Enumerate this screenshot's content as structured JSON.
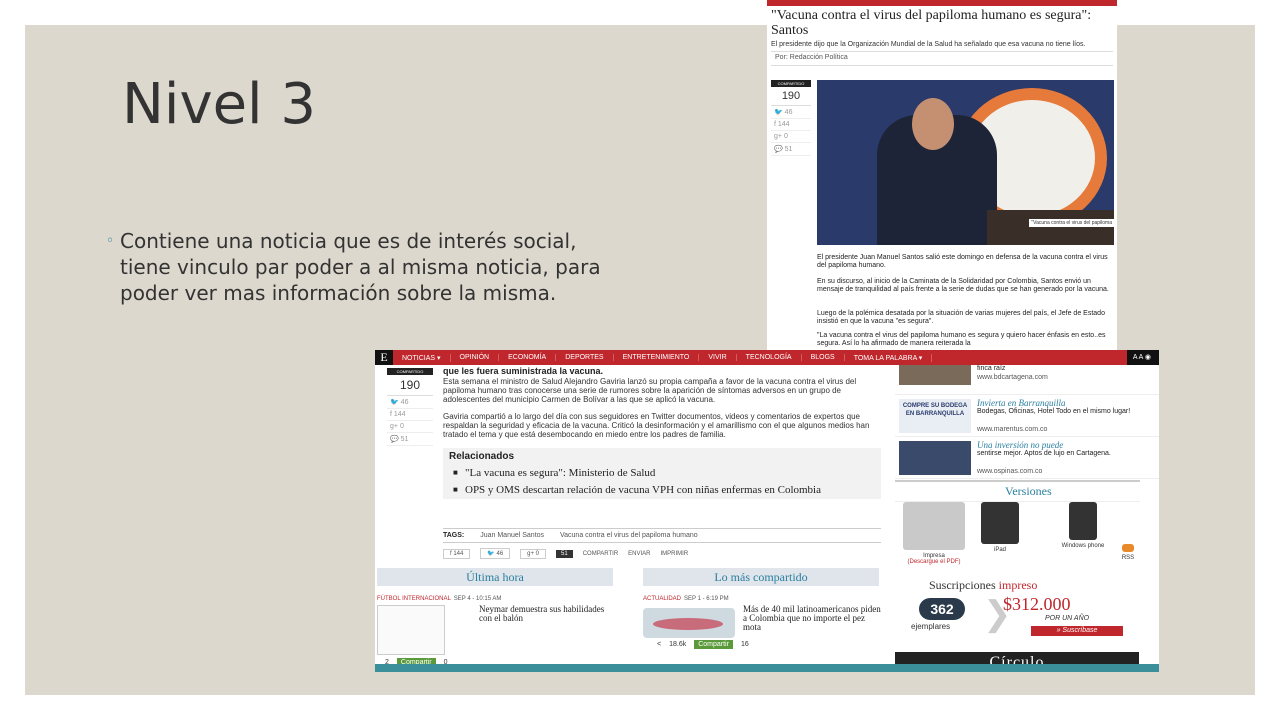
{
  "slide": {
    "title": "Nivel 3",
    "bullet": "Contiene una noticia que es de interés social, tiene vinculo par poder a al misma noticia, para poder ver mas información sobre la misma."
  },
  "top_article": {
    "headline": "\"Vacuna contra el virus del papiloma humano es segura\": Santos",
    "subheadline": "El presidente dijo que la Organización Mundial de la Salud ha señalado que esa vacuna no tiene líos.",
    "byline": "Por: Redacción Política",
    "share_label": "COMPARTIDO",
    "share_total": "190",
    "twitter_count": "46",
    "facebook_count": "144",
    "gplus_count": "0",
    "comments_count": "51",
    "photo_caption": "\"Vacuna contra el virus del papiloma",
    "p1": "El presidente Juan Manuel Santos salió este domingo en defensa de la vacuna contra el virus del papiloma humano.",
    "p2": "En su discurso, al inicio de la Caminata de la Solidaridad por Colombia, Santos envió un mensaje de tranquilidad al país frente a la serie de dudas que se han generado por la vacuna.",
    "p3": "Luego de la polémica desatada por la situación de varias mujeres del país, el Jefe de Estado insistió en que la vacuna \"es segura\".",
    "p4": "\"La vacuna contra el virus del papiloma humano es segura y quiero hacer énfasis en esto..es segura. Así lo ha afirmado de manera reiterada la"
  },
  "bottom_page": {
    "logo": "E",
    "nav": [
      "NOTICIAS ▾",
      "OPINIÓN",
      "ECONOMÍA",
      "DEPORTES",
      "ENTRETENIMIENTO",
      "VIVIR",
      "TECNOLOGÍA",
      "BLOGS",
      "TOMA LA PALABRA ▾"
    ],
    "nav_tools": "A A  ◉",
    "lead": "que les fuera suministrada la vacuna.",
    "share_label": "COMPARTIDO",
    "share_total": "190",
    "twitter_count": "46",
    "facebook_count": "144",
    "gplus_count": "0",
    "comments_count": "51",
    "para1": "Esta semana el ministro de Salud Alejandro Gaviria lanzó su propia campaña a favor de la vacuna contra el virus del papiloma humano tras conocerse una serie de rumores sobre la aparición de síntomas adversos en un grupo de adolescentes del municipio Carmen de Bolívar a las que se aplicó la vacuna.",
    "para2": "Gaviria compartió a lo largo del día con sus seguidores en Twitter documentos, videos y comentarios de expertos que respaldan la seguridad y eficacia de la vacuna. Criticó la desinformación y el amarillismo con el que algunos medios han tratado el tema y que está desembocando en miedo entre los padres de familia.",
    "related_title": "Relacionados",
    "related": [
      "\"La vacuna es segura\": Ministerio de Salud",
      "OPS y OMS descartan relación de vacuna VPH con niñas enfermas en Colombia"
    ],
    "tags_label": "TAGS:",
    "tags": [
      "Juan Manuel Santos",
      "Vacuna contra el virus del papiloma humano"
    ],
    "share_bar": {
      "facebook": "f  144",
      "twitter": "🐦  46",
      "gplus": "g+  0",
      "comments": "51",
      "share": "COMPARTIR",
      "send": "ENVIAR",
      "print": "IMPRIMIR"
    },
    "ultima_hora": {
      "heading": "Última hora",
      "category": "FÚTBOL INTERNACIONAL",
      "date": "SEP 4 - 10:15 AM",
      "title": "Neymar demuestra sus habilidades con el balón",
      "share_count": "2",
      "share_btn": "Compartir",
      "comments": "0"
    },
    "mas_compartido": {
      "heading": "Lo más compartido",
      "category": "ACTUALIDAD",
      "date": "SEP 1 - 6:19 PM",
      "title": "Más de 40 mil latinoamericanos piden a Colombia que no importe el pez mota",
      "share_count": "18.6k",
      "share_btn": "Compartir",
      "comments": "16"
    },
    "ads": [
      {
        "title": "",
        "desc": "finca raíz",
        "url": "www.bdcartagena.com"
      },
      {
        "title": "Invierta en Barranquilla",
        "desc": "Bodegas, Oficinas, Hotel Todo en el mismo lugar!",
        "url": "www.marentus.com.co",
        "badge": "COMPRE SU BODEGA EN BARRANQUILLA"
      },
      {
        "title": "Una inversión no puede",
        "desc": "sentirse mejor. Aptos de lujo en Cartagena.",
        "url": "www.ospinas.com.co"
      }
    ],
    "versiones": {
      "heading": "Versiones",
      "impresa": "Impresa",
      "impresa_sub": "(Descargue el PDF)",
      "ipad": "iPad",
      "windows": "Windows phone",
      "rss": "RSS"
    },
    "subs": {
      "heading": "Suscripciones",
      "heading_red": "impreso",
      "count": "362",
      "count_label": "ejemplares",
      "price": "$312.000",
      "per_year": "POR UN AÑO",
      "button": "» Suscríbase"
    },
    "circulo": "Círculo"
  }
}
